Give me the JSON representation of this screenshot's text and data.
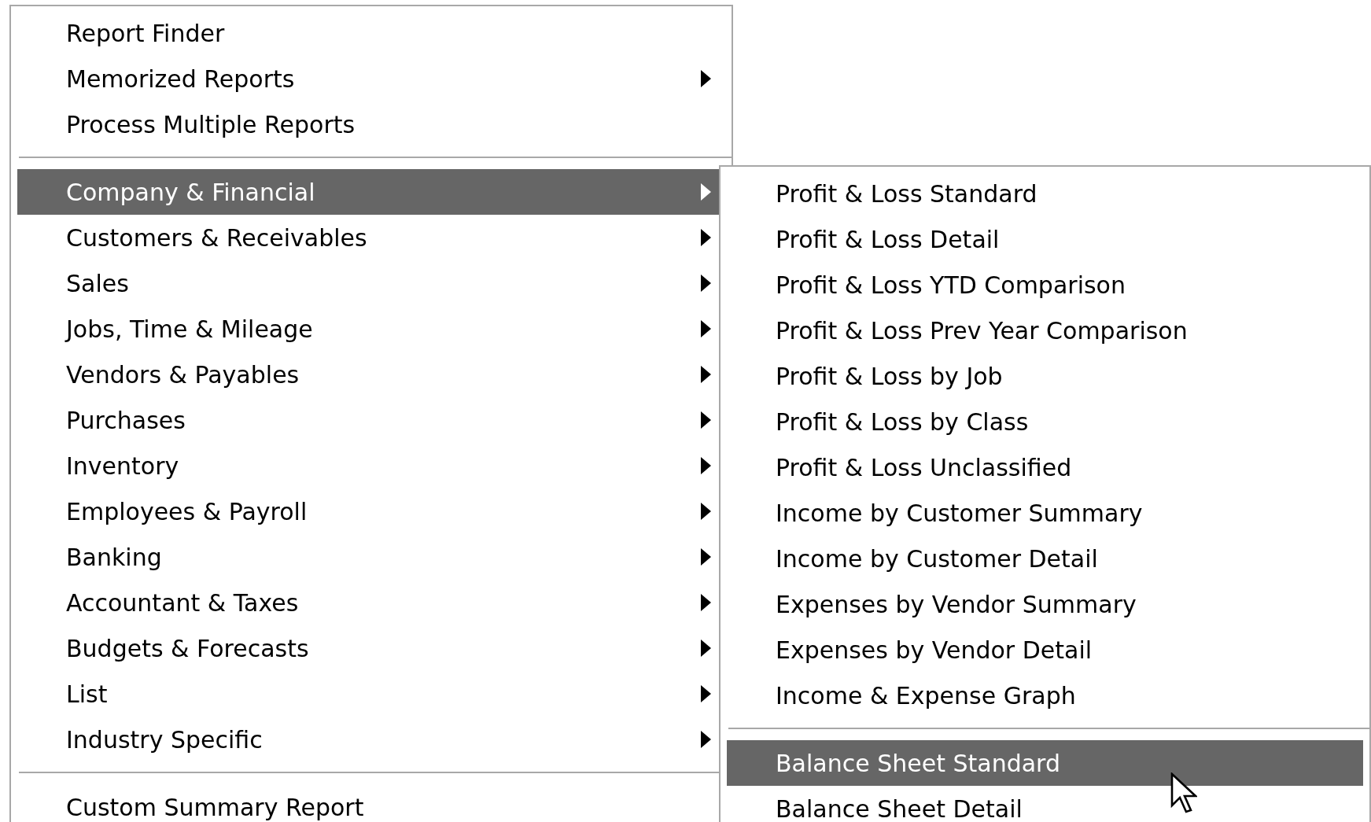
{
  "reports_menu": {
    "items": [
      {
        "kind": "item",
        "label": "Report Finder",
        "submenu": false,
        "selected": false
      },
      {
        "kind": "item",
        "label": "Memorized Reports",
        "submenu": true,
        "selected": false
      },
      {
        "kind": "item",
        "label": "Process Multiple Reports",
        "submenu": false,
        "selected": false
      },
      {
        "kind": "separator"
      },
      {
        "kind": "item",
        "label": "Company & Financial",
        "submenu": true,
        "selected": true
      },
      {
        "kind": "item",
        "label": "Customers & Receivables",
        "submenu": true,
        "selected": false
      },
      {
        "kind": "item",
        "label": "Sales",
        "submenu": true,
        "selected": false
      },
      {
        "kind": "item",
        "label": "Jobs, Time & Mileage",
        "submenu": true,
        "selected": false
      },
      {
        "kind": "item",
        "label": "Vendors & Payables",
        "submenu": true,
        "selected": false
      },
      {
        "kind": "item",
        "label": "Purchases",
        "submenu": true,
        "selected": false
      },
      {
        "kind": "item",
        "label": "Inventory",
        "submenu": true,
        "selected": false
      },
      {
        "kind": "item",
        "label": "Employees & Payroll",
        "submenu": true,
        "selected": false
      },
      {
        "kind": "item",
        "label": "Banking",
        "submenu": true,
        "selected": false
      },
      {
        "kind": "item",
        "label": "Accountant & Taxes",
        "submenu": true,
        "selected": false
      },
      {
        "kind": "item",
        "label": "Budgets & Forecasts",
        "submenu": true,
        "selected": false
      },
      {
        "kind": "item",
        "label": "List",
        "submenu": true,
        "selected": false
      },
      {
        "kind": "item",
        "label": "Industry Specific",
        "submenu": true,
        "selected": false
      },
      {
        "kind": "separator"
      },
      {
        "kind": "item",
        "label": "Custom Summary Report",
        "submenu": false,
        "selected": false
      }
    ]
  },
  "company_financial_submenu": {
    "items": [
      {
        "kind": "item",
        "label": "Profit & Loss Standard",
        "selected": false
      },
      {
        "kind": "item",
        "label": "Profit & Loss Detail",
        "selected": false
      },
      {
        "kind": "item",
        "label": "Profit & Loss YTD Comparison",
        "selected": false
      },
      {
        "kind": "item",
        "label": "Profit & Loss Prev Year Comparison",
        "selected": false
      },
      {
        "kind": "item",
        "label": "Profit & Loss by Job",
        "selected": false
      },
      {
        "kind": "item",
        "label": "Profit & Loss by Class",
        "selected": false
      },
      {
        "kind": "item",
        "label": "Profit & Loss Unclassified",
        "selected": false
      },
      {
        "kind": "item",
        "label": "Income by Customer Summary",
        "selected": false
      },
      {
        "kind": "item",
        "label": "Income by Customer Detail",
        "selected": false
      },
      {
        "kind": "item",
        "label": "Expenses by Vendor Summary",
        "selected": false
      },
      {
        "kind": "item",
        "label": "Expenses by Vendor Detail",
        "selected": false
      },
      {
        "kind": "item",
        "label": "Income & Expense Graph",
        "selected": false
      },
      {
        "kind": "separator"
      },
      {
        "kind": "item",
        "label": "Balance Sheet Standard",
        "selected": true
      },
      {
        "kind": "item",
        "label": "Balance Sheet Detail",
        "selected": false
      }
    ]
  }
}
